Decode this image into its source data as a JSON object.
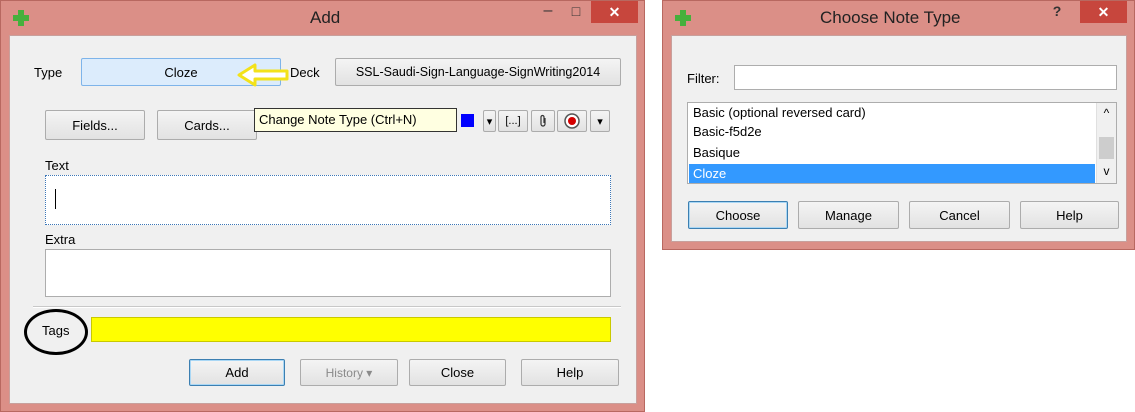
{
  "add_window": {
    "title": "Add",
    "minimize": "–",
    "maximize": "□",
    "close": "✕",
    "type_label": "Type",
    "type_value": "Cloze",
    "deck_label": "Deck",
    "deck_value": "SSL-Saudi-Sign-Language-SignWriting2014",
    "fields_button": "Fields...",
    "cards_button": "Cards...",
    "tooltip": "Change Note Type (Ctrl+N)",
    "toolbar": {
      "dropdown": "▾",
      "cloze": "[...]",
      "attach": "📎",
      "more": "▾"
    },
    "text_label": "Text",
    "extra_label": "Extra",
    "tags_label": "Tags",
    "add_button": "Add",
    "history_button": "History ▾",
    "close_button": "Close",
    "help_button": "Help",
    "colors": {
      "titlebar": "#db8f87",
      "tags_highlight": "#ffff00",
      "arrow": "#f3e21a"
    }
  },
  "choose_window": {
    "title": "Choose Note Type",
    "help_glyph": "?",
    "close": "✕",
    "filter_label": "Filter:",
    "filter_value": "",
    "items": [
      {
        "label": "Basic (optional reversed card)",
        "selected": false
      },
      {
        "label": "Basic-f5d2e",
        "selected": false
      },
      {
        "label": "Basique",
        "selected": false
      },
      {
        "label": "Cloze",
        "selected": true
      }
    ],
    "scroll_up": "^",
    "scroll_down": "v",
    "buttons": {
      "choose": "Choose",
      "manage": "Manage",
      "cancel": "Cancel",
      "help": "Help"
    },
    "colors": {
      "selection": "#3399ff"
    }
  }
}
